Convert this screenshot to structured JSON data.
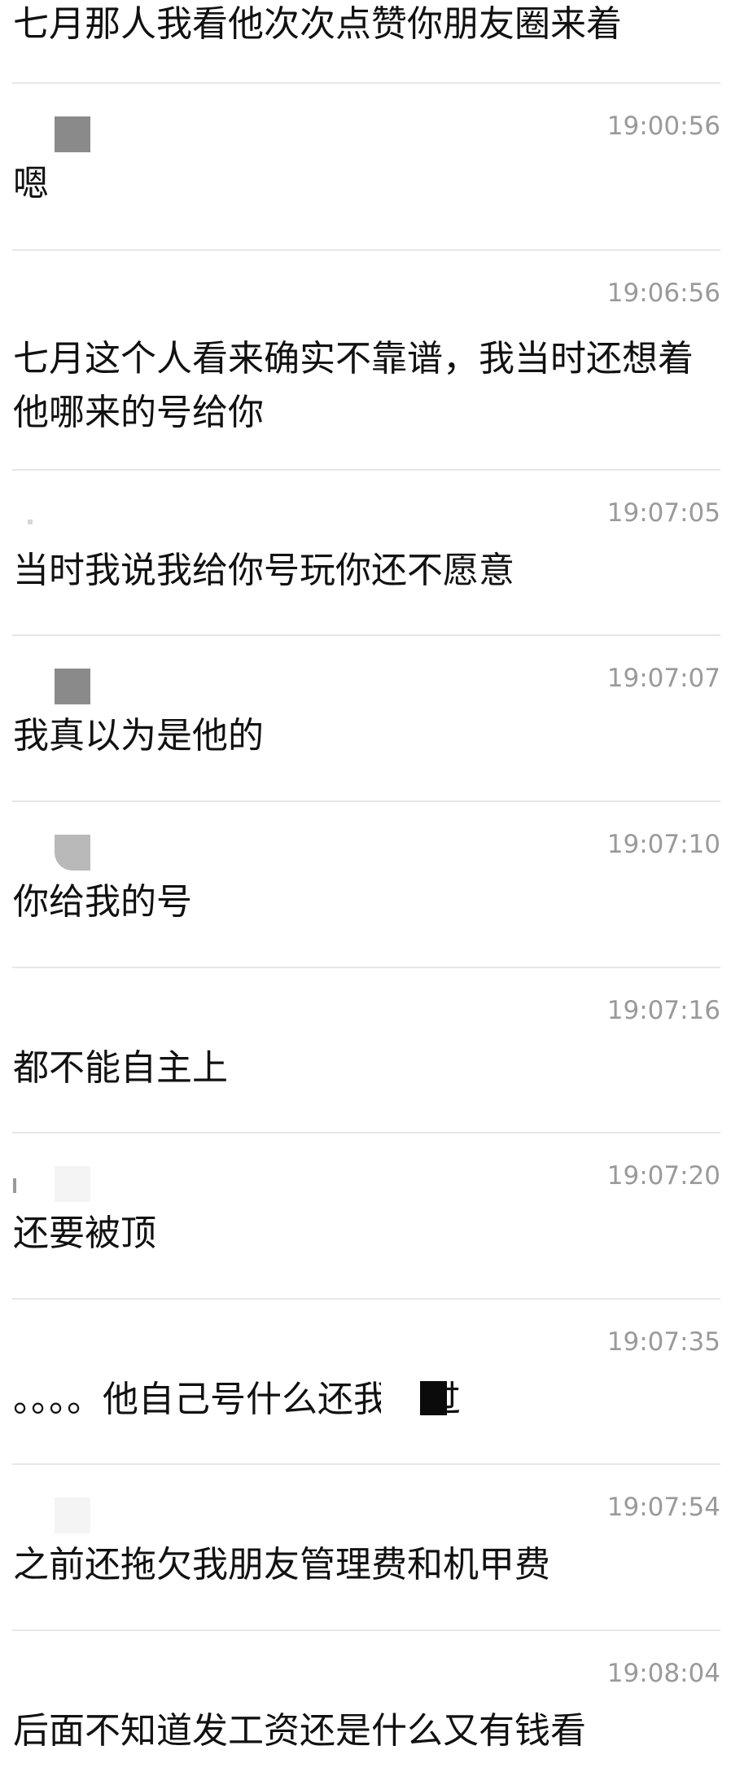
{
  "chat": {
    "top_message": "七月那人我看他次次点赞你朋友圈来着",
    "messages": [
      {
        "time": "19:00:56",
        "text": "嗯"
      },
      {
        "time": "19:06:56",
        "text": "七月这个人看来确实不靠谱，我当时还想着他哪来的号给你"
      },
      {
        "time": "19:07:05",
        "text": "当时我说我给你号玩你还不愿意"
      },
      {
        "time": "19:07:07",
        "text": "我真以为是他的"
      },
      {
        "time": "19:07:10",
        "text": "你给我的号"
      },
      {
        "time": "19:07:16",
        "text": "都不能自主上"
      },
      {
        "time": "19:07:20",
        "text": "还要被顶"
      },
      {
        "time": "19:07:35",
        "text": "。。。。他自己号什么还我上过"
      },
      {
        "time": "19:07:54",
        "text": "之前还拖欠我朋友管理费和机甲费"
      },
      {
        "time": "19:08:04",
        "text": "后面不知道发工资还是什么又有钱看"
      }
    ]
  }
}
